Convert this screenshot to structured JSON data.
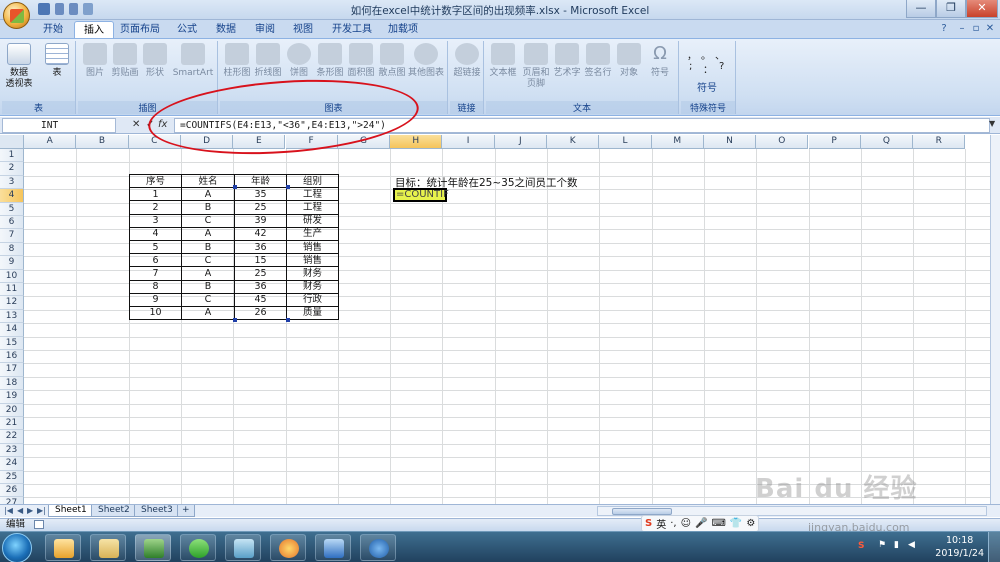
{
  "window": {
    "title": "如何在excel中统计数字区间的出现频率.xlsx - Microsoft Excel",
    "minimize": "—",
    "restore": "❐",
    "close": "✕"
  },
  "ribbon_tabs": [
    "开始",
    "插入",
    "页面布局",
    "公式",
    "数据",
    "审阅",
    "视图",
    "开发工具",
    "加载项"
  ],
  "ribbon": {
    "groups": {
      "table": {
        "label": "表",
        "buttons": [
          "数据\n透视表",
          "表"
        ]
      },
      "illustrations": {
        "label": "插图",
        "buttons": [
          "图片",
          "剪贴画",
          "形状",
          "SmartArt"
        ]
      },
      "charts": {
        "label": "图表",
        "buttons": [
          "柱形图",
          "折线图",
          "饼图",
          "条形图",
          "面积图",
          "散点图",
          "其他图表"
        ]
      },
      "links": {
        "label": "链接",
        "buttons": [
          "超链接"
        ]
      },
      "text": {
        "label": "文本",
        "buttons": [
          "文本框",
          "页眉和\n页脚",
          "艺术字",
          "签名行",
          "对象",
          "符号"
        ]
      },
      "special": {
        "label": "特殊符号",
        "symbols": [
          "，",
          "。",
          "、",
          ";",
          "：",
          "?"
        ],
        "button": "符号"
      }
    }
  },
  "formula_bar": {
    "name_box": "INT",
    "cancel": "✕",
    "enter": "✓",
    "fx": "fx",
    "formula": "=COUNTIFS(E4:E13,\"<36\",E4:E13,\">24\")"
  },
  "columns": [
    "A",
    "B",
    "C",
    "D",
    "E",
    "F",
    "G",
    "H",
    "I",
    "J",
    "K",
    "L",
    "M",
    "N",
    "O",
    "P",
    "Q",
    "R"
  ],
  "rows": [
    "1",
    "2",
    "3",
    "4",
    "5",
    "6",
    "7",
    "8",
    "9",
    "10",
    "11",
    "12",
    "13",
    "14",
    "15",
    "16",
    "17",
    "18",
    "19",
    "20",
    "21",
    "22",
    "23",
    "24",
    "25",
    "26",
    "27"
  ],
  "table": {
    "headers": [
      "序号",
      "姓名",
      "年龄",
      "组别"
    ],
    "rows": [
      [
        "1",
        "A",
        "35",
        "工程"
      ],
      [
        "2",
        "B",
        "25",
        "工程"
      ],
      [
        "3",
        "C",
        "39",
        "研发"
      ],
      [
        "4",
        "A",
        "42",
        "生产"
      ],
      [
        "5",
        "B",
        "36",
        "销售"
      ],
      [
        "6",
        "C",
        "15",
        "销售"
      ],
      [
        "7",
        "A",
        "25",
        "财务"
      ],
      [
        "8",
        "B",
        "36",
        "财务"
      ],
      [
        "9",
        "C",
        "45",
        "行政"
      ],
      [
        "10",
        "A",
        "26",
        "质量"
      ]
    ]
  },
  "goal_text": "目标：统计年龄在25~35之间员工个数",
  "active_cell": {
    "ref": "H4",
    "value": "=COUNTIF"
  },
  "sheet_tabs": [
    "Sheet1",
    "Sheet2",
    "Sheet3"
  ],
  "status": {
    "mode": "编辑",
    "ime": [
      "S",
      "英",
      "·,",
      "☺",
      "🎤",
      "⌨",
      "👕",
      "⚙"
    ]
  },
  "taskbar": {
    "time": "10:18",
    "date": "2019/1/24"
  },
  "watermark": {
    "text": "Bai du 经验",
    "url": "jingyan.baidu.com"
  },
  "colors": {
    "accent": "#15428b",
    "annotation": "#d8121c",
    "active_cell_fill": "#e7f24d"
  }
}
